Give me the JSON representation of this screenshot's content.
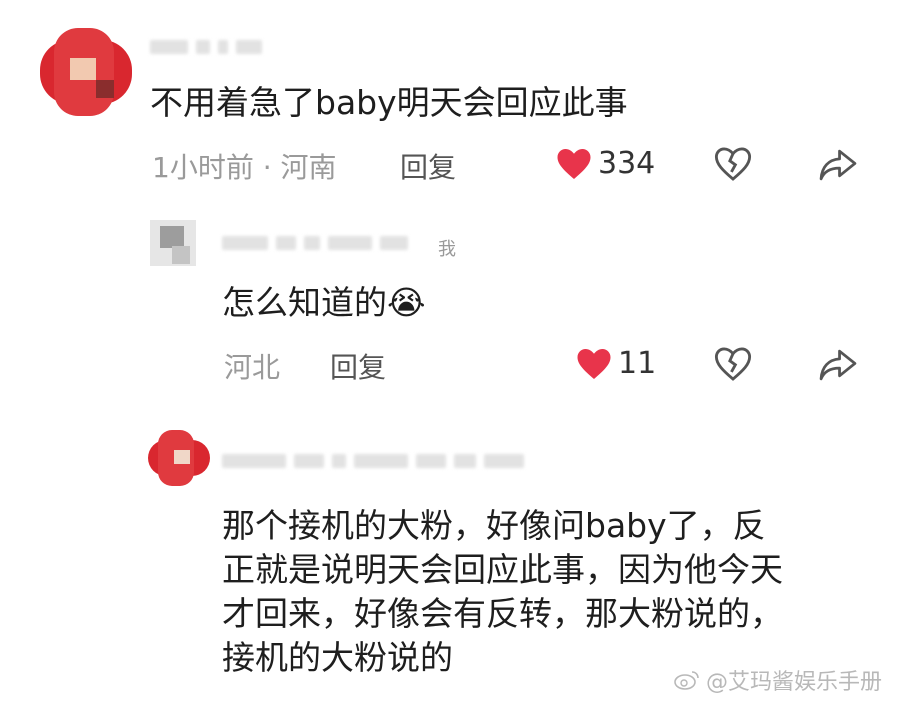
{
  "comment1": {
    "text": "不用着急了baby明天会回应此事",
    "time_location": "1小时前 · 河南",
    "reply_label": "回复",
    "likes": "334"
  },
  "comment2": {
    "tag": "我",
    "text": "怎么知道的",
    "emoji": "😭",
    "location": "河北",
    "reply_label": "回复",
    "likes": "11"
  },
  "comment3": {
    "text_lines": [
      "那个接机的大粉，好像问baby了，反",
      "正就是说明天会回应此事，因为他今天",
      "才回来，好像会有反转，那大粉说的，",
      "接机的大粉说的"
    ]
  },
  "watermark": "@艾玛酱娱乐手册",
  "colors": {
    "heart": "#e8344b",
    "avatar_red": "#d9272f"
  },
  "icons": [
    "heart-icon",
    "broken-heart-icon",
    "share-icon",
    "weibo-icon"
  ]
}
